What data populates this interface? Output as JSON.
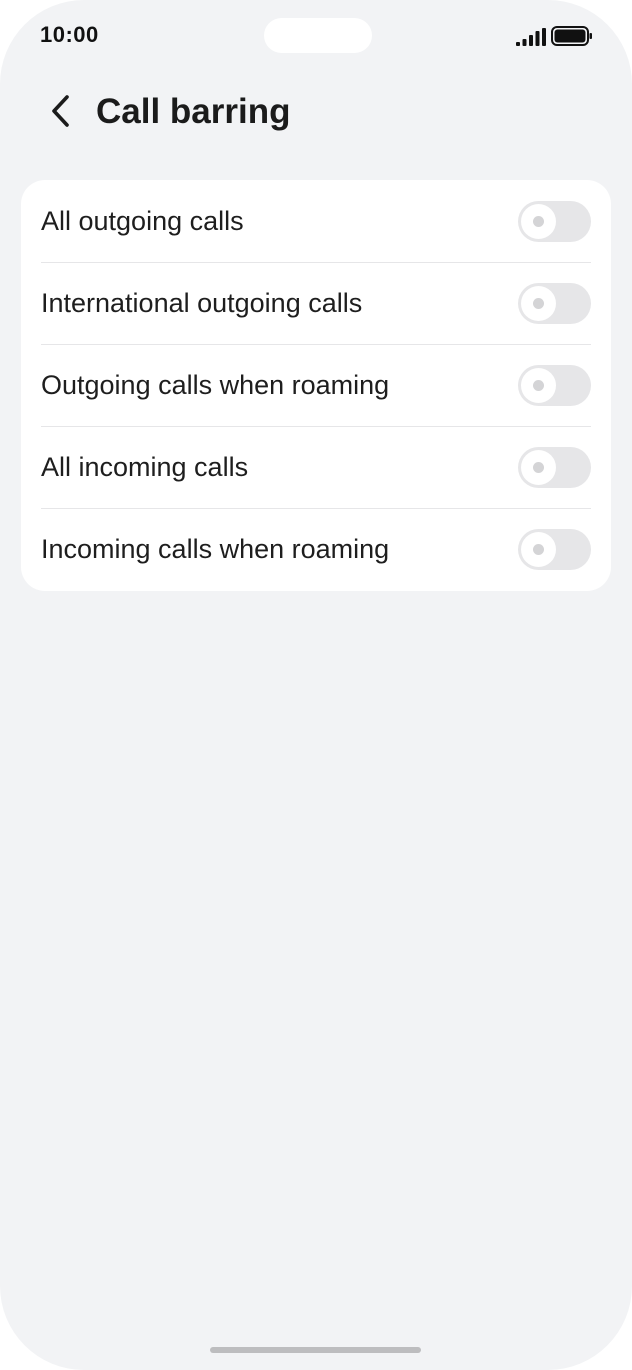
{
  "status_bar": {
    "time": "10:00",
    "signal_icon": "signal-bars-icon",
    "battery_icon": "battery-full-icon"
  },
  "header": {
    "back_icon": "chevron-left-icon",
    "title": "Call barring"
  },
  "settings": {
    "items": [
      {
        "label": "All outgoing calls",
        "enabled": false
      },
      {
        "label": "International outgoing calls",
        "enabled": false
      },
      {
        "label": "Outgoing calls when roaming",
        "enabled": false
      },
      {
        "label": "All incoming calls",
        "enabled": false
      },
      {
        "label": "Incoming calls when roaming",
        "enabled": false
      }
    ]
  },
  "colors": {
    "background": "#f2f3f5",
    "card": "#ffffff",
    "toggle_off_track": "#e6e6e8",
    "text_primary": "#1e1e1e"
  }
}
